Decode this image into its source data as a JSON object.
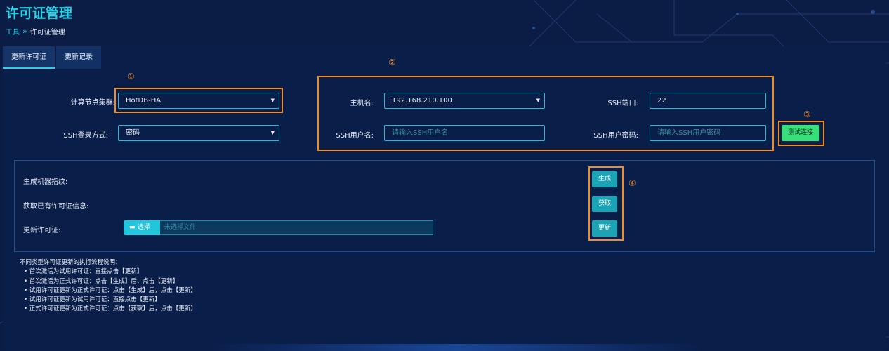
{
  "page": {
    "title": "许可证管理"
  },
  "breadcrumb": {
    "parent": "工具",
    "separator": "»",
    "current": "许可证管理"
  },
  "tabs": [
    {
      "label": "更新许可证",
      "active": true
    },
    {
      "label": "更新记录",
      "active": false
    }
  ],
  "annotations": [
    "①",
    "②",
    "③",
    "④"
  ],
  "form": {
    "cluster_label": "计算节点集群:",
    "cluster_value": "HotDB-HA",
    "ssh_login_label": "SSH登录方式:",
    "ssh_login_value": "密码",
    "host_label": "主机名:",
    "host_value": "192.168.210.100",
    "ssh_port_label": "SSH端口:",
    "ssh_port_value": "22",
    "ssh_user_label": "SSH用户名:",
    "ssh_user_placeholder": "请输入SSH用户名",
    "ssh_pass_label": "SSH用户密码:",
    "ssh_pass_placeholder": "请输入SSH用户密码",
    "test_button": "测试连接"
  },
  "actions": {
    "fingerprint_label": "生成机器指纹:",
    "fingerprint_button": "生成",
    "fetch_label": "获取已有许可证信息:",
    "fetch_button": "获取",
    "update_label": "更新许可证:",
    "choose_button": "选择",
    "file_placeholder": "未选择文件",
    "update_button": "更新"
  },
  "notes": {
    "title": "不同类型许可证更新的执行流程说明：",
    "items": [
      "首次激活为试用许可证：直接点击【更新】",
      "首次激活为正式许可证：点击【生成】后，点击【更新】",
      "试用许可证更新为正式许可证：点击【生成】后，点击【更新】",
      "试用许可证更新为试用许可证：直接点击【更新】",
      "正式许可证更新为正式许可证：点击【获取】后，点击【更新】"
    ]
  },
  "colors": {
    "background": "#0b1c45",
    "accent": "#27d2e8",
    "annotation": "#f28c28",
    "test_button": "#38e07b",
    "action_button": "#1ba3b6"
  },
  "icons": {
    "caret": "caret-down-icon",
    "folder": "folder-open-icon"
  }
}
